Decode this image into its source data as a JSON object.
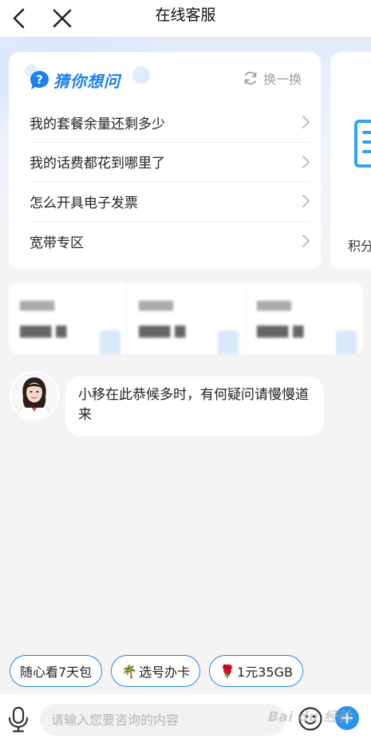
{
  "header": {
    "title": "在线客服"
  },
  "guess": {
    "title": "猜你想问",
    "refresh_label": "换一换",
    "questions": [
      "我的套餐余量还剩多少",
      "我的话费都花到哪里了",
      "怎么开具电子发票",
      "宽带专区"
    ]
  },
  "side_card": {
    "label": "积分"
  },
  "chat": {
    "message": "小移在此恭候多时，有何疑问请慢慢道来"
  },
  "chips": [
    {
      "emoji": "",
      "label": "随心看7天包"
    },
    {
      "emoji": "🌴",
      "label": "选号办卡"
    },
    {
      "emoji": "🌹",
      "label": "1元35GB"
    }
  ],
  "input": {
    "placeholder": "请输入您要咨询的内容",
    "value": ""
  },
  "watermark": {
    "text": "Bai du 经验"
  },
  "colors": {
    "accent": "#1a7ff2",
    "chip_border": "#2483ee",
    "background": "#f4f4f4"
  }
}
